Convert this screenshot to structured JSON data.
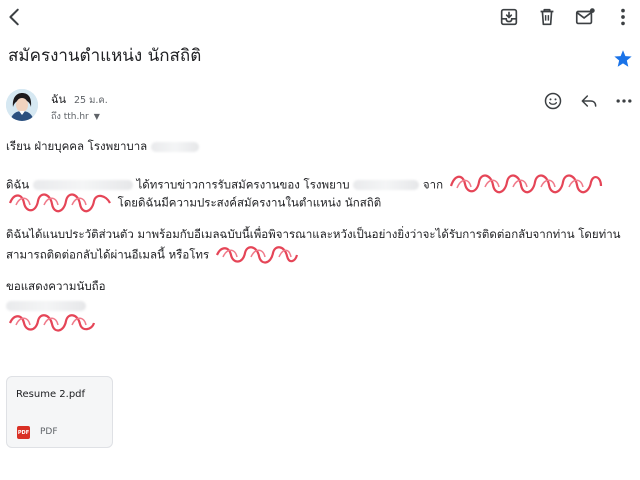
{
  "toolbar": {
    "icons": [
      "back-icon",
      "archive-icon",
      "trash-icon",
      "mark-unread-icon",
      "more-vert-icon"
    ]
  },
  "email": {
    "subject": "สมัครงานตำแหน่ง นักสถิติ",
    "starred": true,
    "sender": "ฉัน",
    "date": "25 ม.ค.",
    "recipient": "ถึง tth.hr",
    "body": {
      "greeting": "เรียน ฝ่ายบุคคล โรงพยาบาล",
      "p1_a": "ดิฉัน",
      "p1_b": "ได้ทราบข่าวการรับสมัครงานของ โรงพยาบ",
      "p1_c": "จาก",
      "p1_d": "โดยดิฉันมีความประสงค์สมัครงานในตำแหน่ง นักสถิติ",
      "p2_line1": "ดิฉันได้แนบประวัติส่วนตัว มาพร้อมกับอีเมลฉบับนี้เพื่อพิจารณาและหวังเป็นอย่างยิ่งว่าจะได้รับการติดต่อกลับจากท่าน โดยท่าน",
      "p2_line2": "สามารถติดต่อกลับได้ผ่านอีเมลนี้ หรือโทร",
      "closing": "ขอแสดงความนับถือ"
    },
    "attachment": {
      "filename": "Resume  2.pdf",
      "type_label": "PDF",
      "type_icon": "PDF"
    }
  },
  "colors": {
    "star": "#1a73e8",
    "pdf_icon": "#d93025",
    "scribble": "#e0243a"
  }
}
